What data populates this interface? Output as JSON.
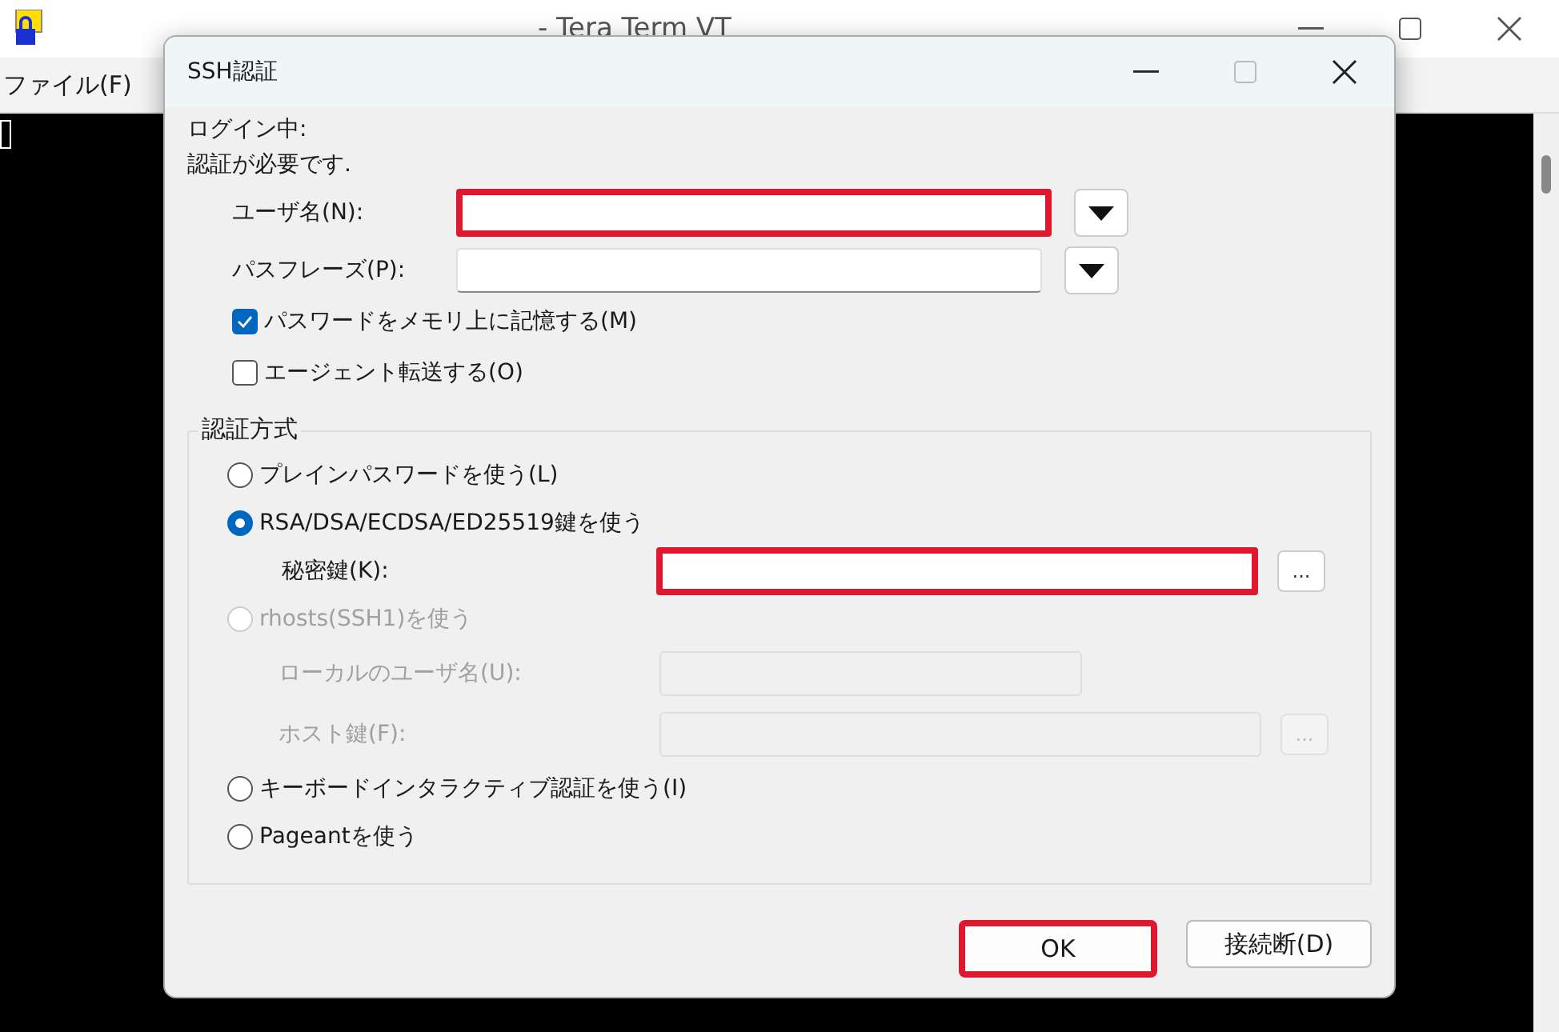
{
  "main_window": {
    "title": "- Tera Term VT",
    "menu": [
      "ファイル(F)"
    ]
  },
  "dialog": {
    "title": "SSH認証",
    "status": "ログイン中:",
    "prompt": "認証が必要です.",
    "fields": [
      {
        "label": "ユーザ名(N):",
        "highlighted": true
      },
      {
        "label": "パスフレーズ(P):",
        "highlighted": false
      }
    ],
    "checkboxes": [
      {
        "label": "パスワードをメモリ上に記憶する(M)",
        "checked": true
      },
      {
        "label": "エージェント転送する(O)",
        "checked": false
      }
    ],
    "group": {
      "title": "認証方式",
      "items": [
        {
          "kind": "radio",
          "label": "プレインパスワードを使う(L)",
          "selected": false,
          "disabled": false
        },
        {
          "kind": "radio",
          "label": "RSA/DSA/ECDSA/ED25519鍵を使う",
          "selected": true,
          "disabled": false
        },
        {
          "kind": "field",
          "label": "秘密鍵(K):",
          "disabled": false,
          "highlighted": true,
          "browse": "..."
        },
        {
          "kind": "radio",
          "label": "rhosts(SSH1)を使う",
          "selected": false,
          "disabled": true
        },
        {
          "kind": "field",
          "label": "ローカルのユーザ名(U):",
          "disabled": true,
          "highlighted": false
        },
        {
          "kind": "field",
          "label": "ホスト鍵(F):",
          "disabled": true,
          "highlighted": false,
          "browse": "..."
        },
        {
          "kind": "radio",
          "label": "キーボードインタラクティブ認証を使う(I)",
          "selected": false,
          "disabled": false
        },
        {
          "kind": "radio",
          "label": "Pageantを使う",
          "selected": false,
          "disabled": false
        }
      ]
    },
    "buttons": [
      {
        "label": "OK",
        "highlighted": true
      },
      {
        "label": "接続断(D)",
        "highlighted": false
      }
    ]
  }
}
